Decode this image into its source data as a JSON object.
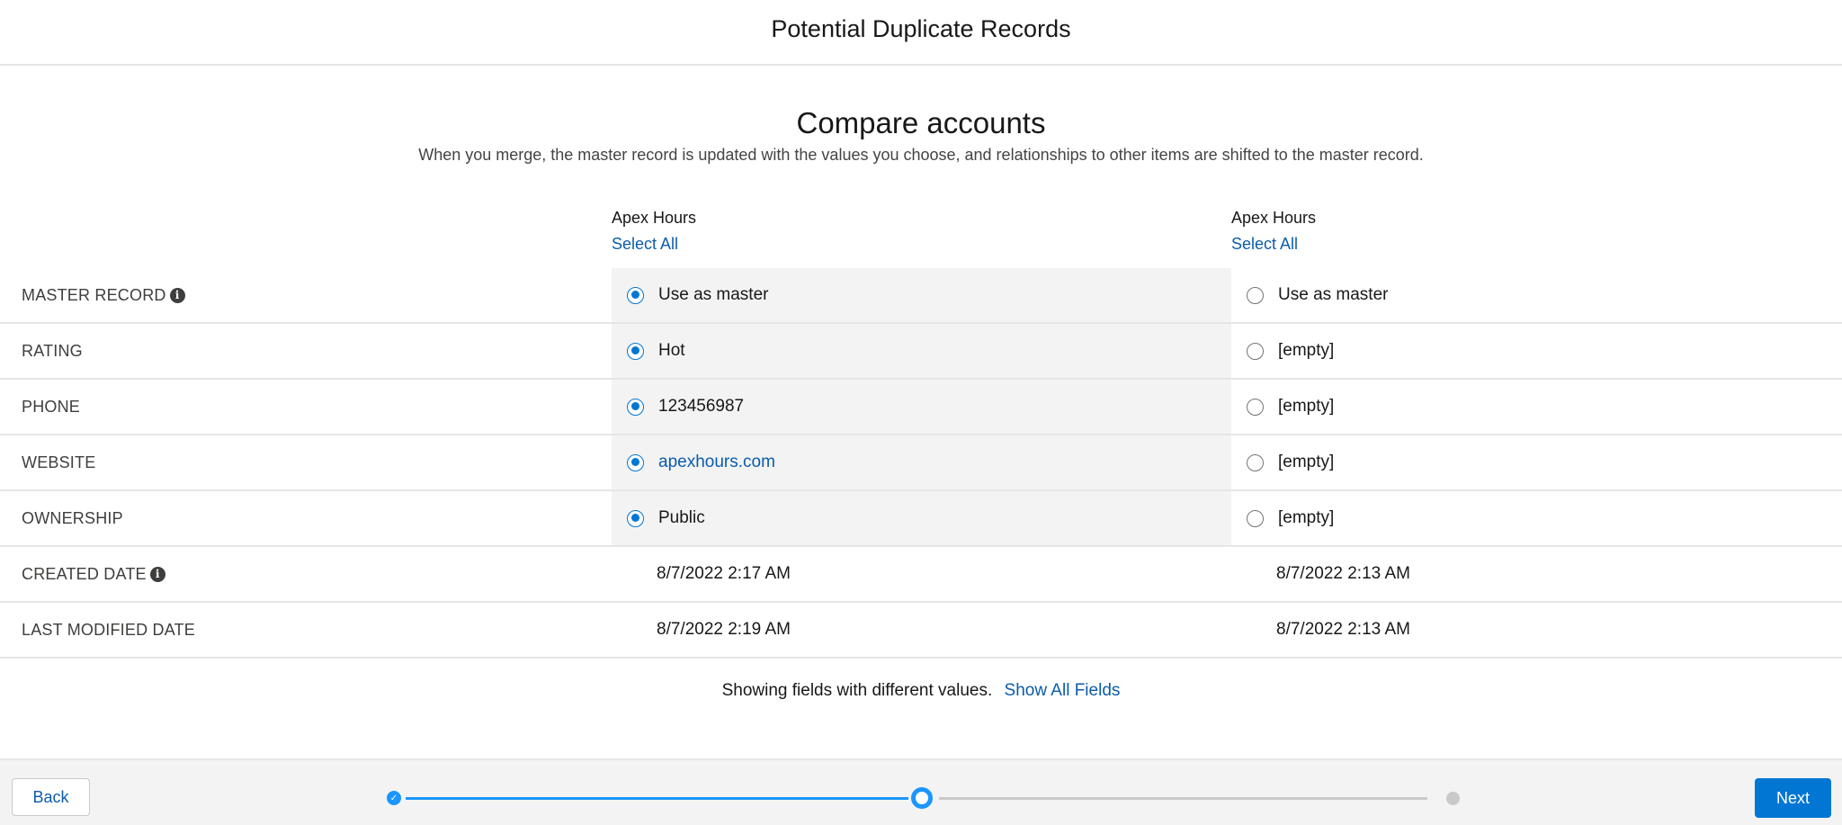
{
  "header": {
    "title": "Potential Duplicate Records"
  },
  "compare": {
    "title": "Compare accounts",
    "description": "When you merge, the master record is updated with the values you choose, and relationships to other items are shifted to the master record."
  },
  "records": [
    {
      "name": "Apex Hours",
      "select_all": "Select All"
    },
    {
      "name": "Apex Hours",
      "select_all": "Select All"
    }
  ],
  "rows": {
    "master": {
      "label": "MASTER RECORD",
      "values": [
        "Use as master",
        "Use as master"
      ],
      "selected": 0
    },
    "rating": {
      "label": "RATING",
      "values": [
        "Hot",
        "[empty]"
      ],
      "selected": 0
    },
    "phone": {
      "label": "PHONE",
      "values": [
        "123456987",
        "[empty]"
      ],
      "selected": 0
    },
    "website": {
      "label": "WEBSITE",
      "values": [
        "apexhours.com",
        "[empty]"
      ],
      "selected": 0
    },
    "ownership": {
      "label": "OWNERSHIP",
      "values": [
        "Public",
        "[empty]"
      ],
      "selected": 0
    },
    "created": {
      "label": "CREATED DATE",
      "values": [
        "8/7/2022 2:17 AM",
        "8/7/2022 2:13 AM"
      ]
    },
    "modified": {
      "label": "LAST MODIFIED DATE",
      "values": [
        "8/7/2022 2:19 AM",
        "8/7/2022 2:13 AM"
      ]
    }
  },
  "footer_note": {
    "text": "Showing fields with different values.",
    "link": "Show All Fields"
  },
  "footer": {
    "back_label": "Back",
    "next_label": "Next",
    "progress": {
      "steps": 3,
      "current_step": 2
    }
  },
  "colors": {
    "accent": "#0176d3",
    "link": "#0b5cab",
    "selected_bg": "#f3f3f3"
  },
  "icons": {
    "info": "info-icon",
    "step_complete": "check-icon"
  }
}
